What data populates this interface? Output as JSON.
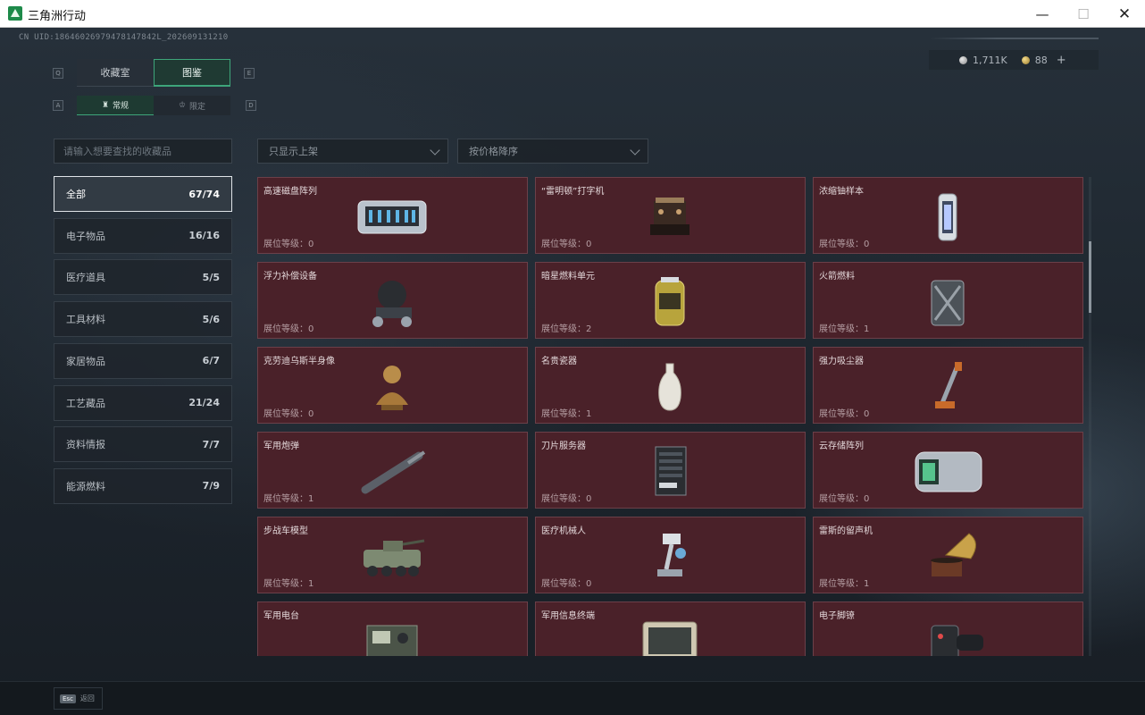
{
  "window": {
    "title": "三角洲行动",
    "minimize": "—",
    "maximize": "☐",
    "close": "✕"
  },
  "uid": "CN UID:18646026979478147842L_202609131210",
  "currency": {
    "silver": "1,711K",
    "gold": "88",
    "add": "+"
  },
  "tabs": {
    "left_key": "Q",
    "right_key": "E",
    "items": [
      {
        "label": "收藏室",
        "active": false
      },
      {
        "label": "图鉴",
        "active": true
      }
    ]
  },
  "subtabs": {
    "left_key": "A",
    "right_key": "D",
    "items": [
      {
        "label": "常规",
        "active": true
      },
      {
        "label": "限定",
        "active": false
      }
    ]
  },
  "search": {
    "placeholder": "请输入想要查找的收藏品"
  },
  "filters": {
    "shelf": "只显示上架",
    "sort": "按价格降序"
  },
  "categories": [
    {
      "label": "全部",
      "count": "67/74",
      "active": true
    },
    {
      "label": "电子物品",
      "count": "16/16",
      "active": false
    },
    {
      "label": "医疗道具",
      "count": "5/5",
      "active": false
    },
    {
      "label": "工具材料",
      "count": "5/6",
      "active": false
    },
    {
      "label": "家居物品",
      "count": "6/7",
      "active": false
    },
    {
      "label": "工艺藏品",
      "count": "21/24",
      "active": false
    },
    {
      "label": "资料情报",
      "count": "7/7",
      "active": false
    },
    {
      "label": "能源燃料",
      "count": "7/9",
      "active": false
    }
  ],
  "items": [
    {
      "name": "高速磁盘阵列",
      "level": "展位等级：0",
      "icon": "disk-array-icon"
    },
    {
      "name": "“雷明顿”打字机",
      "level": "展位等级：0",
      "icon": "typewriter-icon"
    },
    {
      "name": "浓缩铀样本",
      "level": "展位等级：0",
      "icon": "uranium-sample-icon"
    },
    {
      "name": "浮力补偿设备",
      "level": "展位等级：0",
      "icon": "bcd-icon"
    },
    {
      "name": "暗星燃料单元",
      "level": "展位等级：2",
      "icon": "fuel-cell-icon"
    },
    {
      "name": "火箭燃料",
      "level": "展位等级：1",
      "icon": "jerrycan-icon"
    },
    {
      "name": "克劳迪乌斯半身像",
      "level": "展位等级：0",
      "icon": "bust-icon"
    },
    {
      "name": "名贵瓷器",
      "level": "展位等级：1",
      "icon": "vase-icon"
    },
    {
      "name": "强力吸尘器",
      "level": "展位等级：0",
      "icon": "vacuum-icon"
    },
    {
      "name": "军用炮弹",
      "level": "展位等级：1",
      "icon": "shell-icon"
    },
    {
      "name": "刀片服务器",
      "level": "展位等级：0",
      "icon": "server-icon"
    },
    {
      "name": "云存储阵列",
      "level": "展位等级：0",
      "icon": "cloud-storage-icon"
    },
    {
      "name": "步战车模型",
      "level": "展位等级：1",
      "icon": "ifv-model-icon"
    },
    {
      "name": "医疗机械人",
      "level": "展位等级：0",
      "icon": "medical-robot-icon"
    },
    {
      "name": "雷斯的留声机",
      "level": "展位等级：1",
      "icon": "gramophone-icon"
    },
    {
      "name": "军用电台",
      "level": "",
      "icon": "radio-icon"
    },
    {
      "name": "军用信息终端",
      "level": "",
      "icon": "terminal-icon"
    },
    {
      "name": "电子脚镣",
      "level": "",
      "icon": "ankle-monitor-icon"
    }
  ],
  "footer": {
    "esc_key": "Esc",
    "esc_label": "返回"
  }
}
